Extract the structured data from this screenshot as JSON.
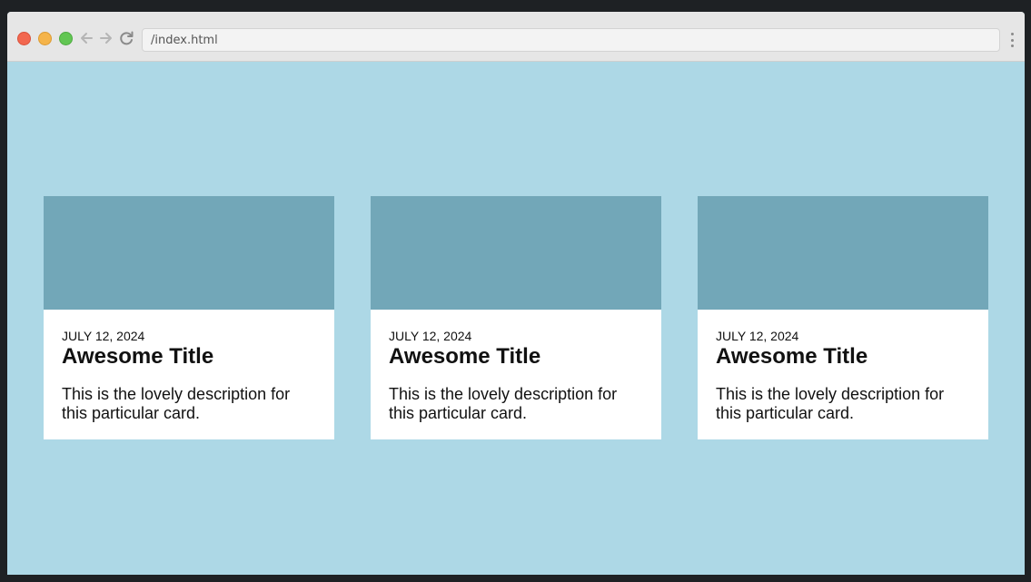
{
  "browser": {
    "url": "/index.html"
  },
  "theme": {
    "page_background": "#add8e6",
    "card_image_color": "#72a7b8",
    "card_background": "#ffffff"
  },
  "cards": [
    {
      "date": "JULY 12, 2024",
      "title": "Awesome Title",
      "description": "This is the lovely description for this particular card."
    },
    {
      "date": "JULY 12, 2024",
      "title": "Awesome Title",
      "description": "This is the lovely description for this particular card."
    },
    {
      "date": "JULY 12, 2024",
      "title": "Awesome Title",
      "description": "This is the lovely description for this particular card."
    }
  ]
}
